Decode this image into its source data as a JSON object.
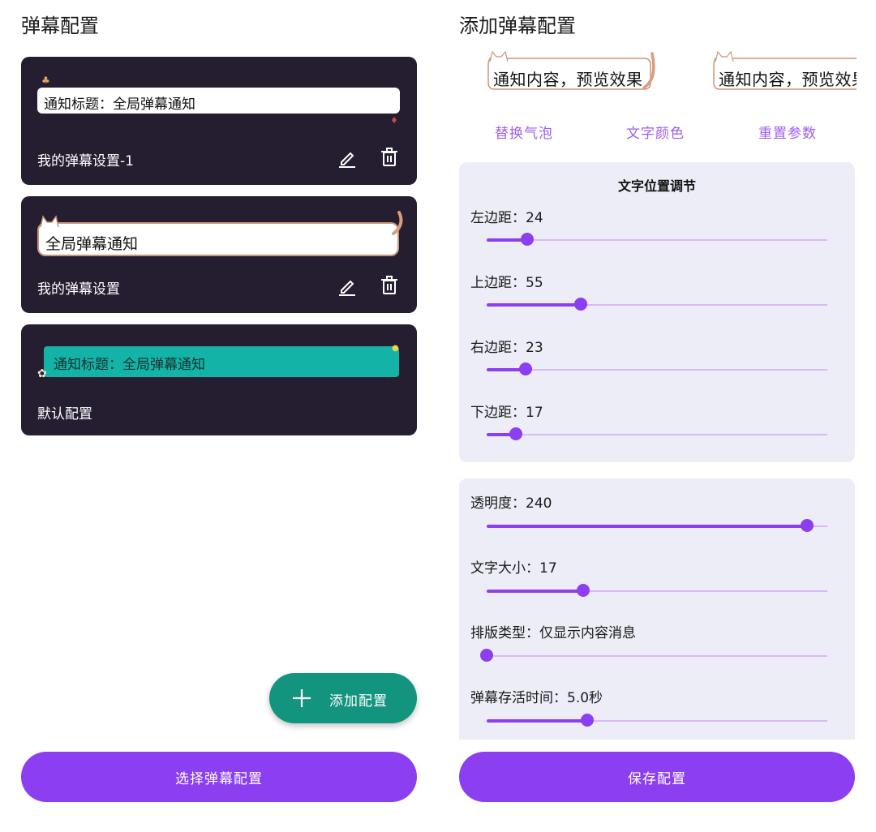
{
  "left": {
    "title": "弹幕配置",
    "cards": [
      {
        "bubble_text": "通知标题：全局弹幕通知",
        "name": "我的弹幕设置-1",
        "edit_label": "编辑",
        "delete_label": "删除"
      },
      {
        "bubble_text": "全局弹幕通知",
        "name": "我的弹幕设置",
        "edit_label": "编辑",
        "delete_label": "删除"
      },
      {
        "bubble_text": "通知标题：全局弹幕通知",
        "name": "默认配置"
      }
    ],
    "fab_label": "添加配置",
    "select_button": "选择弹幕配置"
  },
  "right": {
    "title": "添加弹幕配置",
    "preview_text_1": "通知内容，预览效果",
    "preview_text_2": "通知内容，预览效果",
    "actions": [
      "替换气泡",
      "文字颜色",
      "重置参数"
    ],
    "position_box": {
      "title": "文字位置调节",
      "sliders": [
        {
          "label": "左边距：24",
          "value": 24,
          "max": 200
        },
        {
          "label": "上边距：55",
          "value": 55,
          "max": 200
        },
        {
          "label": "右边距：23",
          "value": 23,
          "max": 200
        },
        {
          "label": "下边距：17",
          "value": 17,
          "max": 200
        }
      ]
    },
    "style_box": {
      "sliders": [
        {
          "label": "透明度：240",
          "value": 240,
          "max": 255
        },
        {
          "label": "文字大小：17",
          "value": 17,
          "max": 60
        },
        {
          "label": "排版类型：仅显示内容消息",
          "value": 0,
          "max": 3
        },
        {
          "label": "弹幕存活时间：5.0秒",
          "value": 5.0,
          "max": 17
        }
      ]
    },
    "save_button": "保存配置"
  },
  "colors": {
    "accent": "#8b3ff0",
    "card_bg": "#251d30",
    "fab": "#13947f",
    "teal_bubble": "#14b3a7",
    "link": "#9d5ee8"
  }
}
